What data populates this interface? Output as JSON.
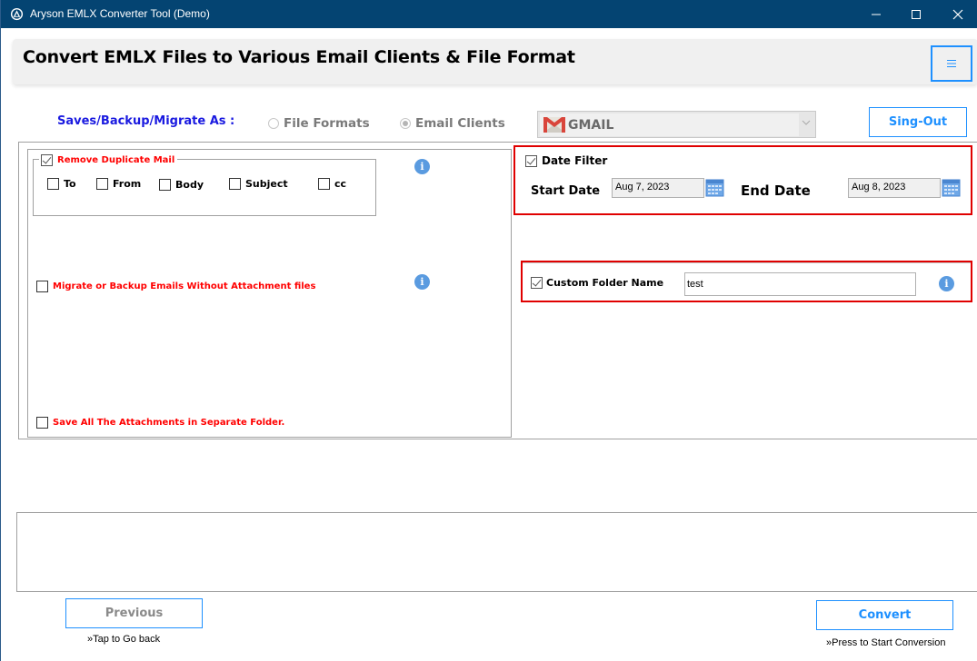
{
  "window": {
    "title": "Aryson EMLX Converter Tool (Demo)",
    "controls": [
      "minimize",
      "maximize",
      "close"
    ]
  },
  "header": {
    "title": "Convert EMLX Files to Various Email Clients & File Format",
    "menu_icon": "hamburger-menu-icon"
  },
  "save_as": {
    "label": "Saves/Backup/Migrate As :",
    "options": [
      {
        "label": "File Formats",
        "selected": false
      },
      {
        "label": "Email Clients",
        "selected": true
      }
    ],
    "client_select": {
      "value": "GMAIL",
      "icon": "gmail-icon"
    },
    "signout_label": "Sing-Out"
  },
  "left_options": {
    "remove_duplicate": {
      "label": "Remove Duplicate Mail",
      "checked": true,
      "fields": [
        {
          "label": "To",
          "checked": false
        },
        {
          "label": "From",
          "checked": false
        },
        {
          "label": "Body",
          "checked": false
        },
        {
          "label": "Subject",
          "checked": false
        },
        {
          "label": "cc",
          "checked": false
        }
      ]
    },
    "without_attachments": {
      "label": "Migrate or Backup Emails Without Attachment files",
      "checked": false
    },
    "separate_attachments": {
      "label": "Save All The Attachments in Separate Folder.",
      "checked": false
    },
    "info_icon": "i"
  },
  "date_filter": {
    "label": "Date Filter",
    "checked": true,
    "start_label": "Start Date",
    "start_value": "Aug 7, 2023",
    "end_label": "End Date",
    "end_value": "Aug 8, 2023"
  },
  "custom_folder": {
    "label": "Custom Folder Name",
    "checked": true,
    "value": "test",
    "info_icon": "i"
  },
  "footer": {
    "previous_label": "Previous",
    "previous_hint": "»Tap to Go back",
    "convert_label": "Convert",
    "convert_hint": "»Press to Start Conversion"
  },
  "colors": {
    "titlebar": "#044472",
    "accent_blue": "#1e90ff",
    "highlight_red": "#e00000",
    "label_red": "#ff0000",
    "save_as_blue": "#1a1ae0"
  }
}
